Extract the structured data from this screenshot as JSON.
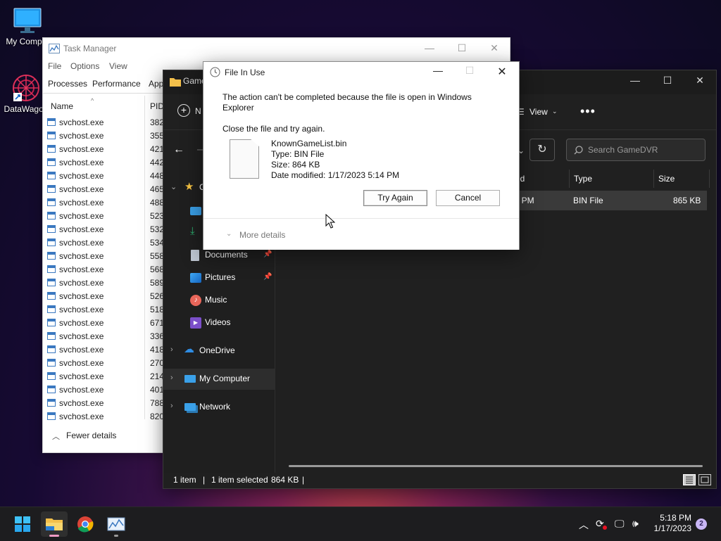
{
  "desktop": {
    "icons": [
      {
        "label": "My Comput"
      },
      {
        "label": "DataWagon"
      }
    ]
  },
  "task_manager": {
    "title": "Task Manager",
    "menu": [
      "File",
      "Options",
      "View"
    ],
    "tabs": [
      "Processes",
      "Performance",
      "App"
    ],
    "columns": {
      "name": "Name",
      "pid": "PID"
    },
    "rows": [
      {
        "name": "svchost.exe",
        "pid": "382"
      },
      {
        "name": "svchost.exe",
        "pid": "355"
      },
      {
        "name": "svchost.exe",
        "pid": "421"
      },
      {
        "name": "svchost.exe",
        "pid": "442"
      },
      {
        "name": "svchost.exe",
        "pid": "448"
      },
      {
        "name": "svchost.exe",
        "pid": "465"
      },
      {
        "name": "svchost.exe",
        "pid": "488"
      },
      {
        "name": "svchost.exe",
        "pid": "523"
      },
      {
        "name": "svchost.exe",
        "pid": "532"
      },
      {
        "name": "svchost.exe",
        "pid": "534"
      },
      {
        "name": "svchost.exe",
        "pid": "558"
      },
      {
        "name": "svchost.exe",
        "pid": "568"
      },
      {
        "name": "svchost.exe",
        "pid": "589"
      },
      {
        "name": "svchost.exe",
        "pid": "526"
      },
      {
        "name": "svchost.exe",
        "pid": "518"
      },
      {
        "name": "svchost.exe",
        "pid": "671"
      },
      {
        "name": "svchost.exe",
        "pid": "336"
      },
      {
        "name": "svchost.exe",
        "pid": "418"
      },
      {
        "name": "svchost.exe",
        "pid": "270"
      },
      {
        "name": "svchost.exe",
        "pid": "214"
      },
      {
        "name": "svchost.exe",
        "pid": "401"
      },
      {
        "name": "svchost.exe",
        "pid": "788"
      },
      {
        "name": "svchost.exe",
        "pid": "820"
      }
    ],
    "fewer_details": "Fewer details"
  },
  "explorer": {
    "tab_fragment": "Game",
    "new_fragment": "N",
    "view_label": "View",
    "more_label": "•••",
    "search_placeholder": "Search GameDVR",
    "nav": {
      "quick_access_fragment": "C",
      "documents": "Documents",
      "pictures": "Pictures",
      "music": "Music",
      "videos": "Videos",
      "onedrive": "OneDrive",
      "my_computer": "My Computer",
      "network": "Network"
    },
    "columns": {
      "date_fragment": "ed",
      "type": "Type",
      "size": "Size"
    },
    "file_row": {
      "date_fragment": "14 PM",
      "type": "BIN File",
      "size": "865 KB"
    },
    "status": {
      "items": "1 item",
      "selected": "1 item selected",
      "size": "864 KB"
    }
  },
  "dialog": {
    "title": "File In Use",
    "message": "The action can't be completed because the file is open in Windows Explorer",
    "instruction": "Close the file and try again.",
    "file": {
      "name": "KnownGameList.bin",
      "type": "Type: BIN File",
      "size": "Size: 864 KB",
      "modified": "Date modified: 1/17/2023 5:14 PM"
    },
    "try_again": "Try Again",
    "cancel": "Cancel",
    "more_details": "More details"
  },
  "taskbar": {
    "time": "5:18 PM",
    "date": "1/17/2023",
    "notification_count": "2"
  },
  "colors": {
    "accent": "#0078d4",
    "explorer_bg": "#202020",
    "selected_nav": "#2d2d2d"
  }
}
